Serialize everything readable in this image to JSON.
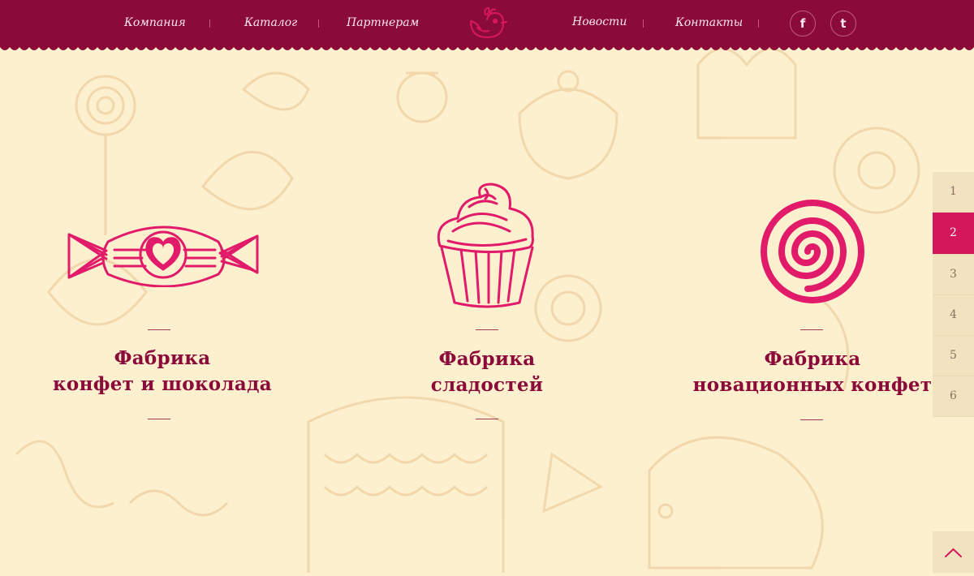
{
  "nav": {
    "left": [
      "Компания",
      "Каталог",
      "Партнерам"
    ],
    "right": [
      "Новости",
      "Контакты"
    ]
  },
  "social": {
    "facebook": "f",
    "tumblr": "t"
  },
  "factories": [
    {
      "icon": "candy-icon",
      "line1": "Фабрика",
      "line2": "конфет и шоколада"
    },
    {
      "icon": "cupcake-icon",
      "line1": "Фабрика",
      "line2": "сладостей"
    },
    {
      "icon": "lollipop-icon",
      "line1": "Фабрика",
      "line2": "новационных конфет"
    }
  ],
  "pager": {
    "pages": [
      "1",
      "2",
      "3",
      "4",
      "5",
      "6"
    ],
    "active": "2"
  },
  "colors": {
    "header": "#8a0a3a",
    "accent": "#d4175a",
    "background": "#fdf0cf",
    "doodle": "#f2d9ad"
  }
}
